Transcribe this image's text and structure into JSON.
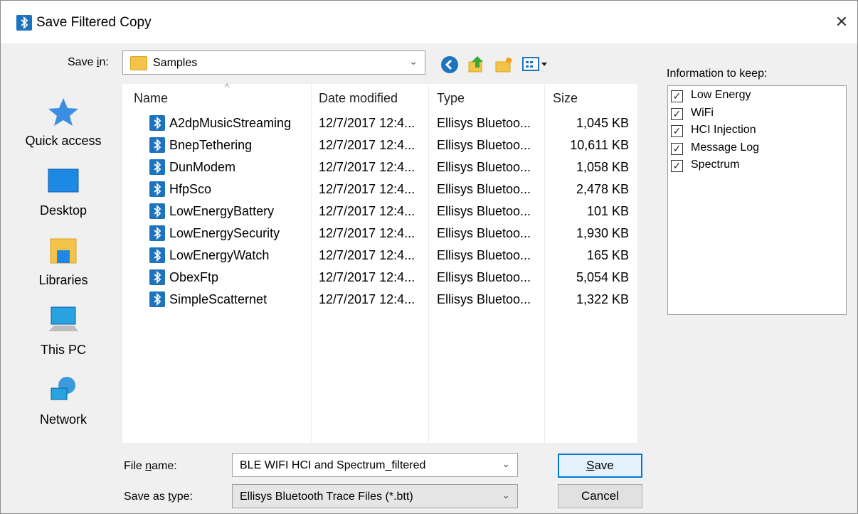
{
  "window": {
    "title": "Save Filtered Copy",
    "close_glyph": "✕"
  },
  "save_in": {
    "label_pre": "Save ",
    "label_key": "i",
    "label_post": "n:",
    "value": "Samples",
    "arrow": "⌄"
  },
  "toolbar": {
    "back_icon": "back-icon",
    "up_icon": "up-folder-icon",
    "new_folder_icon": "new-folder-icon",
    "view_menu_icon": "view-menu-icon"
  },
  "places": [
    {
      "label": "Quick access",
      "icon": "star-icon"
    },
    {
      "label": "Desktop",
      "icon": "desktop-icon"
    },
    {
      "label": "Libraries",
      "icon": "libraries-icon"
    },
    {
      "label": "This PC",
      "icon": "computer-icon"
    },
    {
      "label": "Network",
      "icon": "network-icon"
    }
  ],
  "columns": {
    "name": "Name",
    "date": "Date modified",
    "type": "Type",
    "size": "Size",
    "sort_caret": "^"
  },
  "files": [
    {
      "name": "A2dpMusicStreaming",
      "date": "12/7/2017 12:4...",
      "type": "Ellisys Bluetoo...",
      "size": "1,045 KB"
    },
    {
      "name": "BnepTethering",
      "date": "12/7/2017 12:4...",
      "type": "Ellisys Bluetoo...",
      "size": "10,611 KB"
    },
    {
      "name": "DunModem",
      "date": "12/7/2017 12:4...",
      "type": "Ellisys Bluetoo...",
      "size": "1,058 KB"
    },
    {
      "name": "HfpSco",
      "date": "12/7/2017 12:4...",
      "type": "Ellisys Bluetoo...",
      "size": "2,478 KB"
    },
    {
      "name": "LowEnergyBattery",
      "date": "12/7/2017 12:4...",
      "type": "Ellisys Bluetoo...",
      "size": "101 KB"
    },
    {
      "name": "LowEnergySecurity",
      "date": "12/7/2017 12:4...",
      "type": "Ellisys Bluetoo...",
      "size": "1,930 KB"
    },
    {
      "name": "LowEnergyWatch",
      "date": "12/7/2017 12:4...",
      "type": "Ellisys Bluetoo...",
      "size": "165 KB"
    },
    {
      "name": "ObexFtp",
      "date": "12/7/2017 12:4...",
      "type": "Ellisys Bluetoo...",
      "size": "5,054 KB"
    },
    {
      "name": "SimpleScatternet",
      "date": "12/7/2017 12:4...",
      "type": "Ellisys Bluetoo...",
      "size": "1,322 KB"
    }
  ],
  "keep": {
    "label": "Information to keep:",
    "check_glyph": "✓",
    "items": [
      {
        "label": "Low Energy",
        "checked": true
      },
      {
        "label": "WiFi",
        "checked": true
      },
      {
        "label": "HCI Injection",
        "checked": true
      },
      {
        "label": "Message Log",
        "checked": true
      },
      {
        "label": "Spectrum",
        "checked": true
      }
    ]
  },
  "file_name": {
    "label_pre": "File ",
    "label_key": "n",
    "label_post": "ame:",
    "value": "BLE WIFI HCI and Spectrum_filtered",
    "arrow": "⌄"
  },
  "save_type": {
    "label_pre": "Save as ",
    "label_key": "t",
    "label_post": "ype:",
    "value": "Ellisys Bluetooth Trace Files (*.btt)",
    "arrow": "⌄"
  },
  "buttons": {
    "save_key": "S",
    "save_rest": "ave",
    "cancel": "Cancel"
  },
  "colors": {
    "accent": "#0078d7",
    "bluetooth_blue": "#1e73be",
    "folder": "#f4c44a"
  }
}
